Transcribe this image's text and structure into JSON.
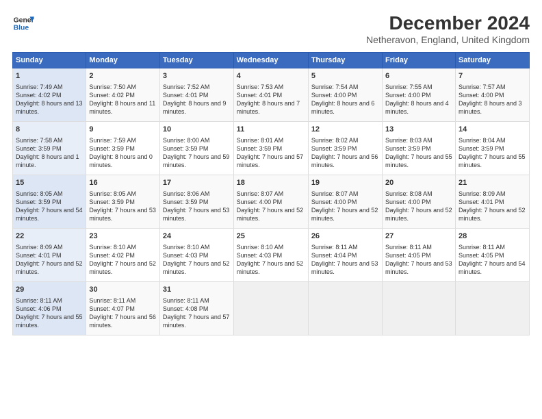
{
  "logo": {
    "line1": "General",
    "line2": "Blue"
  },
  "title": "December 2024",
  "subtitle": "Netheravon, England, United Kingdom",
  "weekdays": [
    "Sunday",
    "Monday",
    "Tuesday",
    "Wednesday",
    "Thursday",
    "Friday",
    "Saturday"
  ],
  "weeks": [
    [
      {
        "day": 1,
        "rise": "7:49 AM",
        "set": "4:02 PM",
        "daylight": "8 hours and 13 minutes."
      },
      {
        "day": 2,
        "rise": "7:50 AM",
        "set": "4:02 PM",
        "daylight": "8 hours and 11 minutes."
      },
      {
        "day": 3,
        "rise": "7:52 AM",
        "set": "4:01 PM",
        "daylight": "8 hours and 9 minutes."
      },
      {
        "day": 4,
        "rise": "7:53 AM",
        "set": "4:01 PM",
        "daylight": "8 hours and 7 minutes."
      },
      {
        "day": 5,
        "rise": "7:54 AM",
        "set": "4:00 PM",
        "daylight": "8 hours and 6 minutes."
      },
      {
        "day": 6,
        "rise": "7:55 AM",
        "set": "4:00 PM",
        "daylight": "8 hours and 4 minutes."
      },
      {
        "day": 7,
        "rise": "7:57 AM",
        "set": "4:00 PM",
        "daylight": "8 hours and 3 minutes."
      }
    ],
    [
      {
        "day": 8,
        "rise": "7:58 AM",
        "set": "3:59 PM",
        "daylight": "8 hours and 1 minute."
      },
      {
        "day": 9,
        "rise": "7:59 AM",
        "set": "3:59 PM",
        "daylight": "8 hours and 0 minutes."
      },
      {
        "day": 10,
        "rise": "8:00 AM",
        "set": "3:59 PM",
        "daylight": "7 hours and 59 minutes."
      },
      {
        "day": 11,
        "rise": "8:01 AM",
        "set": "3:59 PM",
        "daylight": "7 hours and 57 minutes."
      },
      {
        "day": 12,
        "rise": "8:02 AM",
        "set": "3:59 PM",
        "daylight": "7 hours and 56 minutes."
      },
      {
        "day": 13,
        "rise": "8:03 AM",
        "set": "3:59 PM",
        "daylight": "7 hours and 55 minutes."
      },
      {
        "day": 14,
        "rise": "8:04 AM",
        "set": "3:59 PM",
        "daylight": "7 hours and 55 minutes."
      }
    ],
    [
      {
        "day": 15,
        "rise": "8:05 AM",
        "set": "3:59 PM",
        "daylight": "7 hours and 54 minutes."
      },
      {
        "day": 16,
        "rise": "8:05 AM",
        "set": "3:59 PM",
        "daylight": "7 hours and 53 minutes."
      },
      {
        "day": 17,
        "rise": "8:06 AM",
        "set": "3:59 PM",
        "daylight": "7 hours and 53 minutes."
      },
      {
        "day": 18,
        "rise": "8:07 AM",
        "set": "4:00 PM",
        "daylight": "7 hours and 52 minutes."
      },
      {
        "day": 19,
        "rise": "8:07 AM",
        "set": "4:00 PM",
        "daylight": "7 hours and 52 minutes."
      },
      {
        "day": 20,
        "rise": "8:08 AM",
        "set": "4:00 PM",
        "daylight": "7 hours and 52 minutes."
      },
      {
        "day": 21,
        "rise": "8:09 AM",
        "set": "4:01 PM",
        "daylight": "7 hours and 52 minutes."
      }
    ],
    [
      {
        "day": 22,
        "rise": "8:09 AM",
        "set": "4:01 PM",
        "daylight": "7 hours and 52 minutes."
      },
      {
        "day": 23,
        "rise": "8:10 AM",
        "set": "4:02 PM",
        "daylight": "7 hours and 52 minutes."
      },
      {
        "day": 24,
        "rise": "8:10 AM",
        "set": "4:03 PM",
        "daylight": "7 hours and 52 minutes."
      },
      {
        "day": 25,
        "rise": "8:10 AM",
        "set": "4:03 PM",
        "daylight": "7 hours and 52 minutes."
      },
      {
        "day": 26,
        "rise": "8:11 AM",
        "set": "4:04 PM",
        "daylight": "7 hours and 53 minutes."
      },
      {
        "day": 27,
        "rise": "8:11 AM",
        "set": "4:05 PM",
        "daylight": "7 hours and 53 minutes."
      },
      {
        "day": 28,
        "rise": "8:11 AM",
        "set": "4:05 PM",
        "daylight": "7 hours and 54 minutes."
      }
    ],
    [
      {
        "day": 29,
        "rise": "8:11 AM",
        "set": "4:06 PM",
        "daylight": "7 hours and 55 minutes."
      },
      {
        "day": 30,
        "rise": "8:11 AM",
        "set": "4:07 PM",
        "daylight": "7 hours and 56 minutes."
      },
      {
        "day": 31,
        "rise": "8:11 AM",
        "set": "4:08 PM",
        "daylight": "7 hours and 57 minutes."
      },
      null,
      null,
      null,
      null
    ]
  ]
}
